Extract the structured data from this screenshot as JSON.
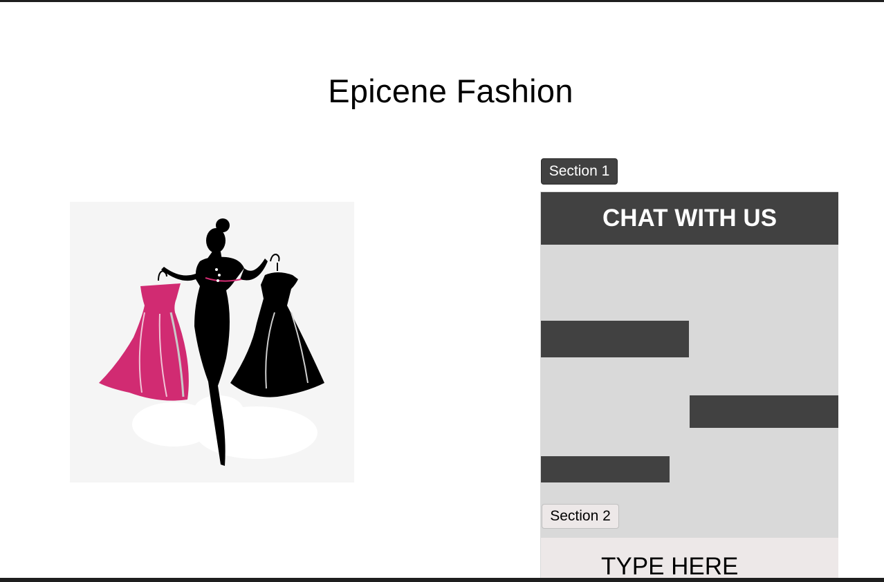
{
  "page": {
    "title": "Epicene Fashion"
  },
  "colors": {
    "dark": "#414141",
    "panel_bg": "#d9d9d9",
    "input_bg": "#ede8e8",
    "dress_pink": "#d12b72",
    "border": "#1e1e1e"
  },
  "hero": {
    "image": "fashion-silhouette-with-dresses"
  },
  "chat": {
    "section1_label": "Section 1",
    "header": "CHAT WITH US",
    "messages": [
      "",
      "",
      ""
    ],
    "section2_label": "Section 2",
    "input_placeholder": "TYPE HERE"
  }
}
